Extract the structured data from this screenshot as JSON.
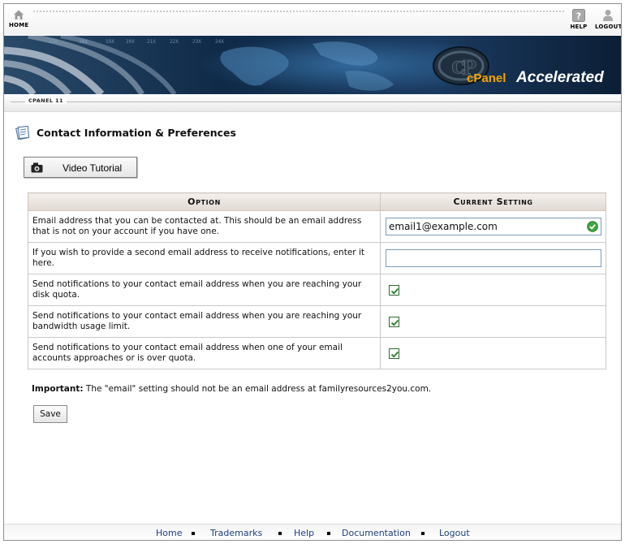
{
  "topnav": {
    "home_label": "HOME",
    "help_label": "HELP",
    "logout_label": "LOGOUT"
  },
  "banner": {
    "logo_text_cpanel": "cPanel",
    "logo_text_accel": "Accelerated",
    "version": "CPANEL 11"
  },
  "page": {
    "title": "Contact Information & Preferences",
    "video_button": "Video Tutorial"
  },
  "table": {
    "headers": [
      "Option",
      "Current Setting"
    ],
    "rows": [
      {
        "option": "Email address that you can be contacted at. This should be an email address that is not on your account if you have one.",
        "type": "text",
        "value": "email1@example.com"
      },
      {
        "option": "If you wish to provide a second email address to receive notifications, enter it here.",
        "type": "text",
        "value": ""
      },
      {
        "option": "Send notifications to your contact email address when you are reaching your disk quota.",
        "type": "checkbox",
        "checked": true
      },
      {
        "option": "Send notifications to your contact email address when you are reaching your bandwidth usage limit.",
        "type": "checkbox",
        "checked": true
      },
      {
        "option": "Send notifications to your contact email address when one of your email accounts approaches or is over quota.",
        "type": "checkbox",
        "checked": true
      }
    ]
  },
  "important": {
    "label": "Important:",
    "text": " The \"email\" setting should not be an email address at familyresources2you.com."
  },
  "save_label": "Save",
  "footer": {
    "links": [
      "Home",
      "Trademarks",
      "Help",
      "Documentation",
      "Logout"
    ]
  },
  "colors": {
    "link": "#1f3f7f",
    "check": "#2f8a2f",
    "header_bg": "#e8e1dc"
  }
}
